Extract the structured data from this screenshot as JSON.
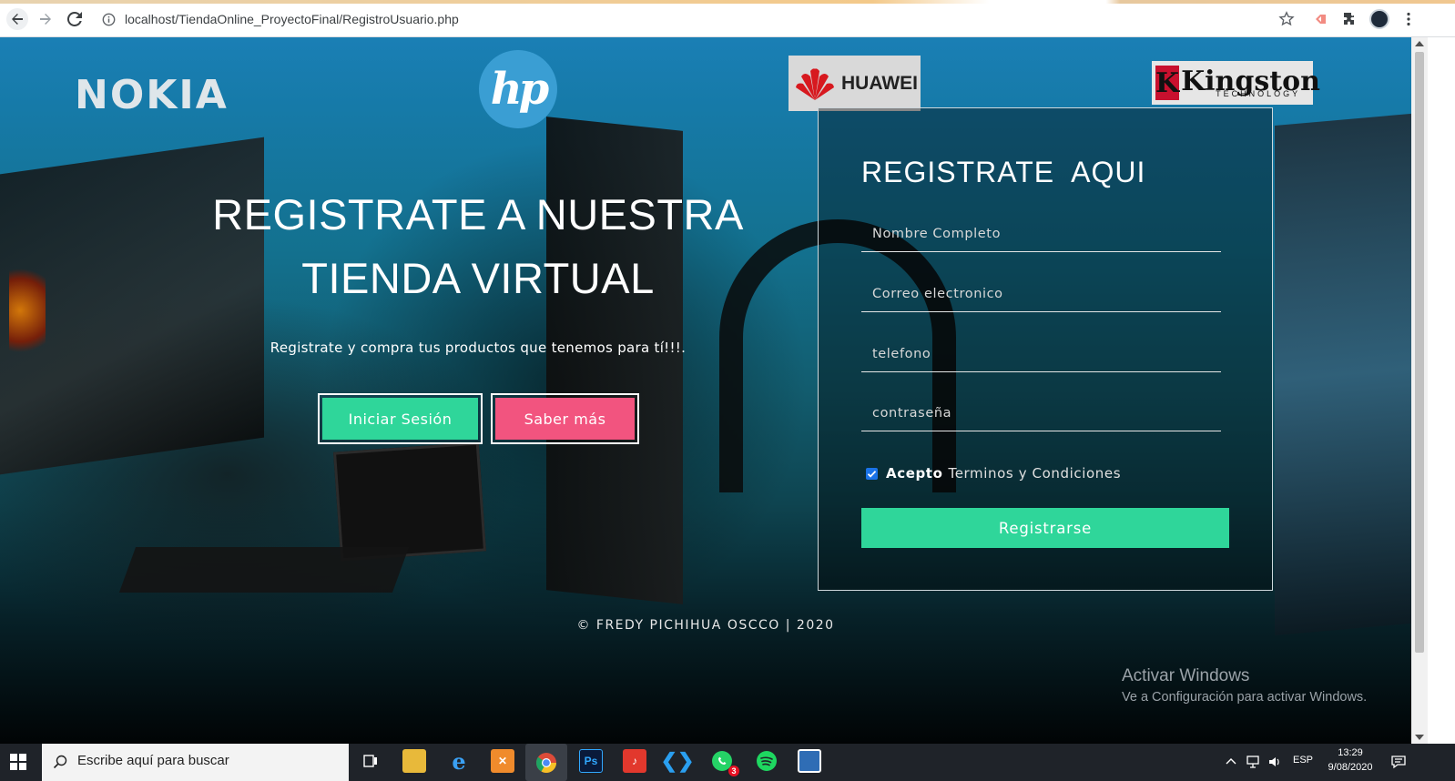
{
  "browser": {
    "url": "localhost/TiendaOnline_ProyectoFinal/RegistroUsuario.php"
  },
  "brands": {
    "nokia": "NOKIA",
    "hp": "hp",
    "huawei": "HUAWEI",
    "kingston": "Kingston",
    "kingston_sub": "TECHNOLOGY"
  },
  "hero": {
    "title": "REGISTRATE A NUESTRA TIENDA VIRTUAL",
    "subtitle": "Registrate y compra tus productos que tenemos para tí!!!.",
    "login_button": "Iniciar Sesión",
    "more_button": "Saber más"
  },
  "register": {
    "title": "REGISTRATE  AQUI",
    "fields": {
      "name_placeholder": "Nombre Completo",
      "email_placeholder": "Correo electronico",
      "phone_placeholder": "telefono",
      "password_placeholder": "contraseña"
    },
    "terms_accept": "Acepto",
    "terms_link": "Terminos y Condiciones",
    "terms_checked": true,
    "submit": "Registrarse"
  },
  "footer": {
    "copyright": "© FREDY PICHIHUA OSCCO | 2020"
  },
  "watermark": {
    "title": "Activar Windows",
    "subtitle": "Ve a Configuración para activar Windows."
  },
  "taskbar": {
    "search_placeholder": "Escribe aquí para buscar",
    "language": "ESP",
    "time": "13:29",
    "date": "9/08/2020",
    "whatsapp_badge": "3"
  },
  "colors": {
    "green": "#2fd69a",
    "pink": "#f2547f"
  }
}
